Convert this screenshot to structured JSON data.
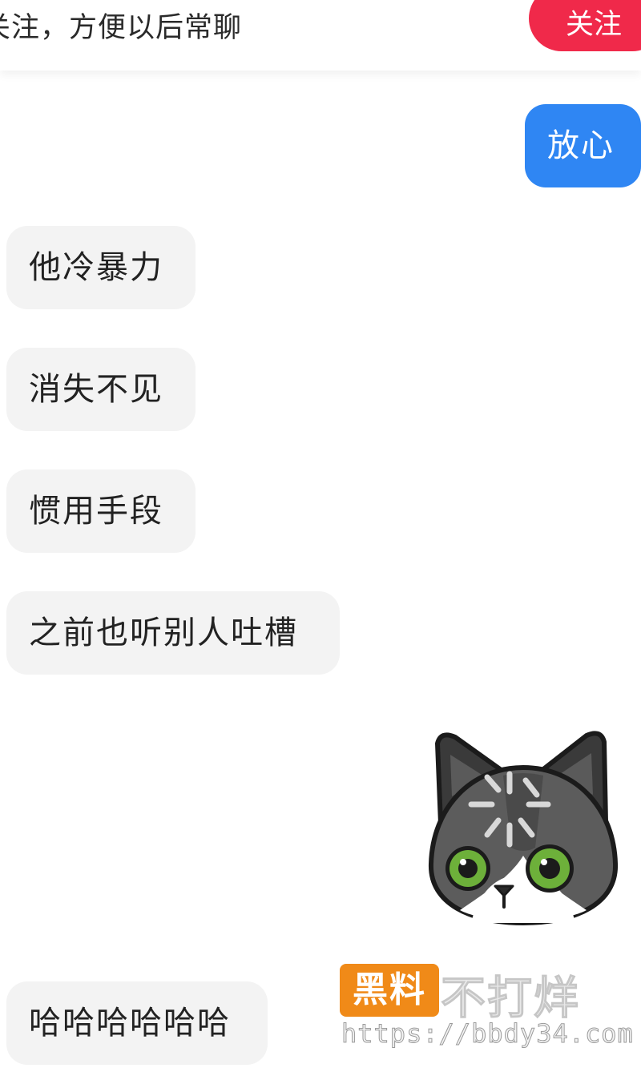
{
  "banner": {
    "text": "关注，方便以后常聊",
    "follow_label": "关注"
  },
  "messages": [
    {
      "side": "outgoing",
      "text": "放心"
    },
    {
      "side": "incoming",
      "text": "他冷暴力"
    },
    {
      "side": "incoming",
      "text": "消失不见"
    },
    {
      "side": "incoming",
      "text": "惯用手段"
    },
    {
      "side": "incoming",
      "text": "之前也听别人吐槽"
    },
    {
      "side": "outgoing",
      "type": "sticker",
      "sticker": "cat-sticker-icon"
    },
    {
      "side": "incoming",
      "text": "哈哈哈哈哈哈"
    }
  ],
  "watermark": {
    "badge": "黑料",
    "title": "不打烊",
    "url": "https://bbdy34.com"
  },
  "colors": {
    "follow_button": "#f0294a",
    "outgoing_bubble": "#2f86f3",
    "incoming_bubble": "#f3f3f3",
    "watermark_badge": "#f08a18"
  }
}
